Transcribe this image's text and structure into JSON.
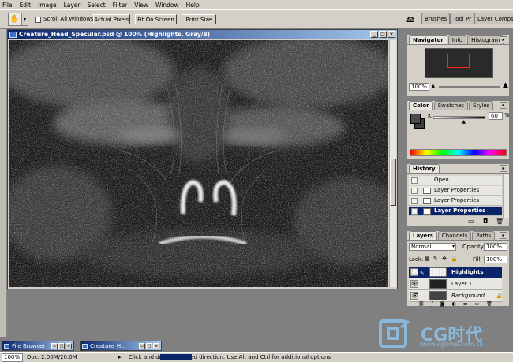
{
  "menu": [
    "File",
    "Edit",
    "Image",
    "Layer",
    "Select",
    "Filter",
    "View",
    "Window",
    "Help"
  ],
  "options": {
    "scroll_all_label": "Scroll All Windows",
    "actual_pixels": "Actual Pixels",
    "fit_on_screen": "Fit On Screen",
    "print_size": "Print Size"
  },
  "wells": [
    "Brushes",
    "Tool Pr",
    "Layer Comps"
  ],
  "document": {
    "title": "Creature_Head_Specular.psd @ 100% (Highlights, Gray/8)"
  },
  "navigator": {
    "tabs": [
      "Navigator",
      "Info",
      "Histogram"
    ],
    "zoom": "100%"
  },
  "color": {
    "tabs": [
      "Color",
      "Swatches",
      "Styles"
    ],
    "channel": "K",
    "value": "60",
    "unit": "%",
    "level": 0.6
  },
  "history": {
    "tab": "History",
    "items": [
      "Open",
      "Layer Properties",
      "Layer Properties",
      "Layer Properties"
    ],
    "selected_index": 3
  },
  "layers": {
    "tabs": [
      "Layers",
      "Channels",
      "Paths"
    ],
    "blend_mode": "Normal",
    "opacity_label": "Opacity:",
    "opacity": "100%",
    "lock_label": "Lock:",
    "fill_label": "Fill:",
    "fill": "100%",
    "items": [
      "Highlights",
      "Layer 1",
      "Background"
    ],
    "selected_index": 0
  },
  "minimized": [
    {
      "title": "File Browser"
    },
    {
      "title": "Creature_H..."
    }
  ],
  "status": {
    "zoom": "100%",
    "doc": "Doc: 2.00M/20.0M",
    "message": "Click and drag                in desired direction.  Use Alt and Ctrl for additional options"
  },
  "watermark": {
    "brand": "CG时代",
    "url": "www.cgtime.com.cn"
  },
  "colors": {
    "titlebar": "#0a246a",
    "chrome": "#d4d0c8",
    "workspace": "#808080",
    "watermark": "#8ab8d8"
  }
}
